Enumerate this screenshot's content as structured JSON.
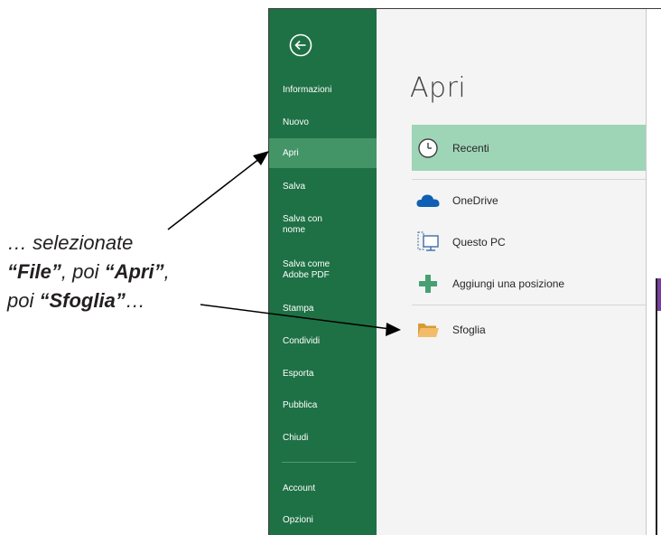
{
  "annotation": {
    "line1": "… selezionate",
    "line2_a": "“File”",
    "line2_b": ", poi ",
    "line2_c": "“Apri”",
    "line2_d": ",",
    "line3_a": "poi ",
    "line3_b": "“Sfoglia”",
    "line3_c": "…"
  },
  "sidebar": {
    "back_icon": "back-arrow-icon",
    "items": [
      {
        "label": "Informazioni"
      },
      {
        "label": "Nuovo"
      },
      {
        "label": "Apri",
        "active": true
      },
      {
        "label": "Salva"
      },
      {
        "label": "Salva con nome"
      },
      {
        "label": "Salva come Adobe PDF"
      },
      {
        "label": "Stampa"
      },
      {
        "label": "Condividi"
      },
      {
        "label": "Esporta"
      },
      {
        "label": "Pubblica"
      },
      {
        "label": "Chiudi"
      }
    ],
    "bottom_items": [
      {
        "label": "Account"
      },
      {
        "label": "Opzioni"
      }
    ]
  },
  "main": {
    "title": "Apri",
    "locations": [
      {
        "label": "Recenti",
        "icon": "clock-icon",
        "active": true
      },
      {
        "label": "OneDrive",
        "icon": "cloud-icon"
      },
      {
        "label": "Questo PC",
        "icon": "computer-icon"
      },
      {
        "label": "Aggiungi una posizione",
        "icon": "plus-icon"
      },
      {
        "label": "Sfoglia",
        "icon": "folder-icon"
      }
    ]
  },
  "colors": {
    "sidebar_bg": "#1e7145",
    "sidebar_active": "#439467",
    "recent_highlight": "#9fd5b7",
    "onedrive_blue": "#0f5fb5",
    "plus_green": "#46a071",
    "folder_orange": "#e8a94a"
  }
}
